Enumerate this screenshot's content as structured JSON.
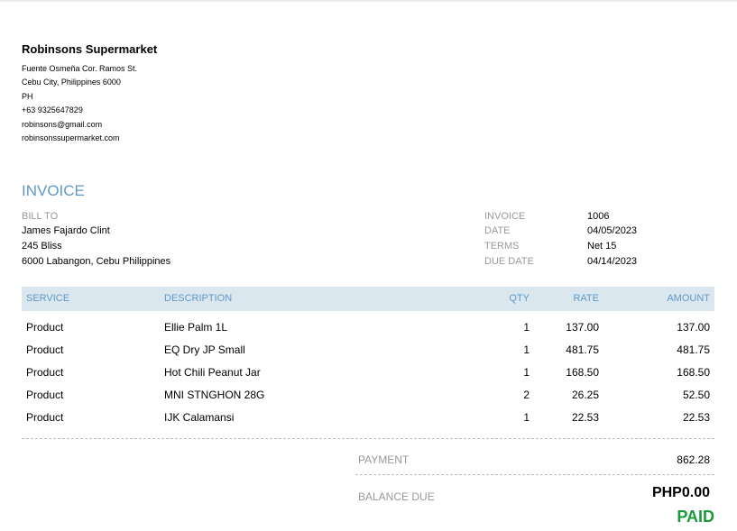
{
  "company": {
    "name": "Robinsons Supermarket",
    "address_lines": [
      "Fuente Osmeña Cor. Ramos St.",
      "Cebu City, Philippines  6000",
      "PH",
      "+63 9325647829",
      "robinsons@gmail.com",
      "robinsonssupermarket.com"
    ]
  },
  "title": "INVOICE",
  "bill_to": {
    "label": "BILL TO",
    "lines": [
      "James Fajardo Clint",
      "245 Bliss",
      "6000 Labangon, Cebu Philippines"
    ]
  },
  "meta": [
    {
      "label": "INVOICE",
      "value": "1006"
    },
    {
      "label": "DATE",
      "value": "04/05/2023"
    },
    {
      "label": "TERMS",
      "value": "Net 15"
    },
    {
      "label": "DUE DATE",
      "value": "04/14/2023"
    }
  ],
  "table": {
    "headers": {
      "service": "SERVICE",
      "description": "DESCRIPTION",
      "qty": "QTY",
      "rate": "RATE",
      "amount": "AMOUNT"
    },
    "rows": [
      {
        "service": "Product",
        "description": "Ellie Palm 1L",
        "qty": "1",
        "rate": "137.00",
        "amount": "137.00"
      },
      {
        "service": "Product",
        "description": "EQ Dry JP Small",
        "qty": "1",
        "rate": "481.75",
        "amount": "481.75"
      },
      {
        "service": "Product",
        "description": "Hot Chili Peanut Jar",
        "qty": "1",
        "rate": "168.50",
        "amount": "168.50"
      },
      {
        "service": "Product",
        "description": "MNI STNGHON 28G",
        "qty": "2",
        "rate": "26.25",
        "amount": "52.50"
      },
      {
        "service": "Product",
        "description": "IJK Calamansi",
        "qty": "1",
        "rate": "22.53",
        "amount": "22.53"
      }
    ]
  },
  "totals": {
    "payment_label": "PAYMENT",
    "payment_value": "862.28",
    "balance_label": "BALANCE DUE",
    "balance_value": "PHP0.00",
    "status": "PAID"
  },
  "colors": {
    "accent": "#5f98c6",
    "header_bg": "#dbe7ef",
    "paid": "#1a9a3a"
  }
}
